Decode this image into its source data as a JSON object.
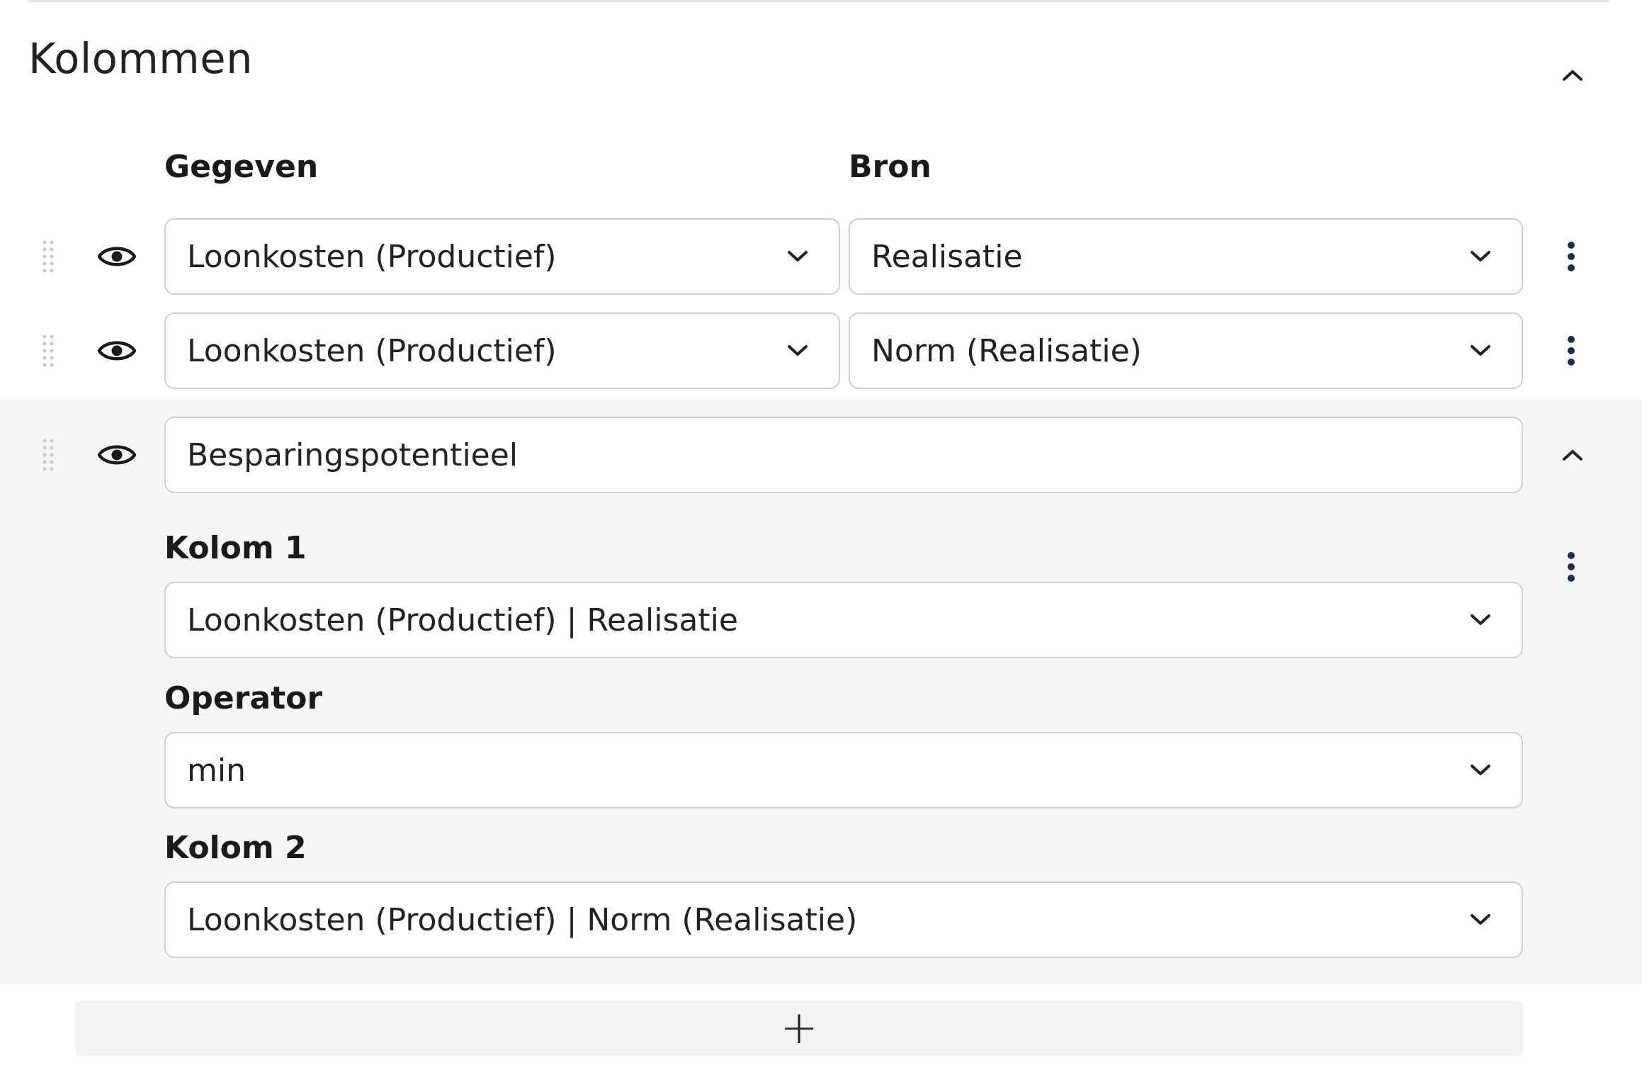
{
  "section": {
    "title": "Kolommen"
  },
  "headers": {
    "gegeven": "Gegeven",
    "bron": "Bron"
  },
  "rows": [
    {
      "gegeven": "Loonkosten (Productief)",
      "bron": "Realisatie"
    },
    {
      "gegeven": "Loonkosten (Productief)",
      "bron": "Norm (Realisatie)"
    }
  ],
  "calc": {
    "name": "Besparingspotentieel",
    "kolom1_label": "Kolom 1",
    "kolom1_value": "Loonkosten (Productief) | Realisatie",
    "operator_label": "Operator",
    "operator_value": "min",
    "kolom2_label": "Kolom 2",
    "kolom2_value": "Loonkosten (Productief) | Norm (Realisatie)"
  },
  "add_button": {
    "label": "+"
  },
  "colors": {
    "kebab": "#1e2a5a",
    "expanded_bg": "#f5f5f5",
    "border": "#cfcfcf"
  }
}
